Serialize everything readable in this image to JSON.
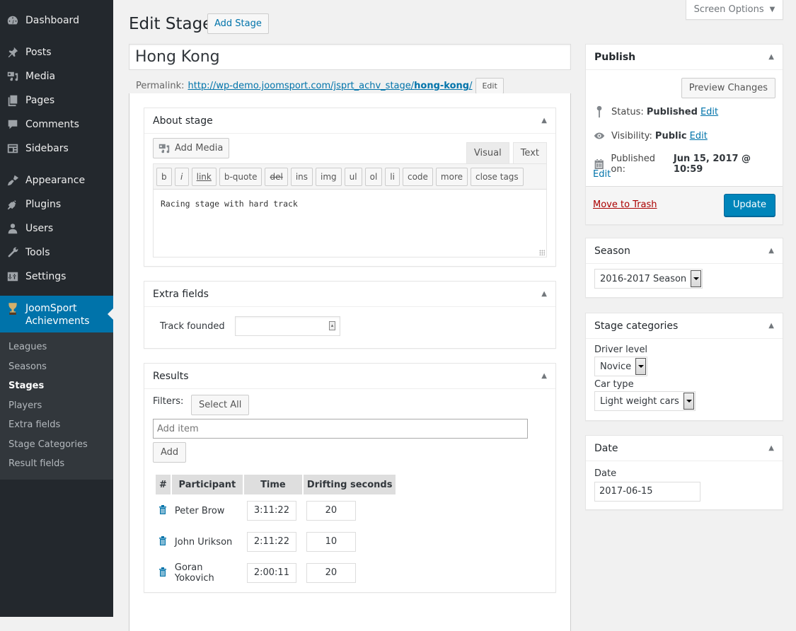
{
  "sidebar": {
    "items": [
      {
        "label": "Dashboard",
        "icon": "dashboard-icon"
      },
      {
        "label": "Posts",
        "icon": "pin-icon"
      },
      {
        "label": "Media",
        "icon": "media-icon"
      },
      {
        "label": "Pages",
        "icon": "pages-icon"
      },
      {
        "label": "Comments",
        "icon": "comment-icon"
      },
      {
        "label": "Sidebars",
        "icon": "sidebars-icon"
      },
      {
        "label": "Appearance",
        "icon": "paintbrush-icon"
      },
      {
        "label": "Plugins",
        "icon": "plugin-icon"
      },
      {
        "label": "Users",
        "icon": "user-icon"
      },
      {
        "label": "Tools",
        "icon": "wrench-icon"
      },
      {
        "label": "Settings",
        "icon": "settings-icon"
      }
    ],
    "active": {
      "label_line1": "JoomSport",
      "label_line2": "Achievments",
      "icon": "trophy-icon",
      "color": "#0073aa"
    },
    "submenu": [
      {
        "label": "Leagues"
      },
      {
        "label": "Seasons"
      },
      {
        "label": "Stages",
        "current": true
      },
      {
        "label": "Players"
      },
      {
        "label": "Extra fields"
      },
      {
        "label": "Stage Categories"
      },
      {
        "label": "Result fields"
      }
    ]
  },
  "header": {
    "screen_options": "Screen Options",
    "title": "Edit Stage",
    "add_new": "Add Stage"
  },
  "post": {
    "title": "Hong Kong",
    "permalink_label": "Permalink:",
    "permalink_base": "http://wp-demo.joomsport.com/jsprt_achv_stage/",
    "permalink_slug": "hong-kong",
    "permalink_trail": "/",
    "permalink_edit": "Edit"
  },
  "about": {
    "title": "About stage",
    "add_media": "Add Media",
    "tab_visual": "Visual",
    "tab_text": "Text",
    "quicktags": [
      "b",
      "i",
      "link",
      "b-quote",
      "del",
      "ins",
      "img",
      "ul",
      "ol",
      "li",
      "code",
      "more",
      "close tags"
    ],
    "content": "Racing stage with hard track"
  },
  "extra_fields": {
    "title": "Extra fields",
    "track_founded_label": "Track founded",
    "track_founded_value": ""
  },
  "results": {
    "title": "Results",
    "filters_label": "Filters:",
    "select_all": "Select All",
    "add_item_placeholder": "Add item",
    "add_button": "Add",
    "columns": [
      "#",
      "Participant",
      "Time",
      "Drifting seconds"
    ],
    "rows": [
      {
        "participant": "Peter Brow",
        "time": "3:11:22",
        "drifting": "20"
      },
      {
        "participant": "John Urikson",
        "time": "2:11:22",
        "drifting": "10"
      },
      {
        "participant": "Goran Yokovich",
        "time": "2:00:11",
        "drifting": "20"
      }
    ]
  },
  "publish": {
    "title": "Publish",
    "preview": "Preview Changes",
    "status_label": "Status:",
    "status_value": "Published",
    "visibility_label": "Visibility:",
    "visibility_value": "Public",
    "published_label": "Published on:",
    "published_value": "Jun 15, 2017 @ 10:59",
    "edit": "Edit",
    "trash": "Move to Trash",
    "update": "Update",
    "update_color": "#0085ba"
  },
  "season": {
    "title": "Season",
    "selected": "2016-2017 Season"
  },
  "categories": {
    "title": "Stage categories",
    "driver_level_label": "Driver level",
    "driver_level_value": "Novice",
    "car_type_label": "Car type",
    "car_type_value": "Light weight cars"
  },
  "date": {
    "title": "Date",
    "label": "Date",
    "value": "2017-06-15"
  }
}
